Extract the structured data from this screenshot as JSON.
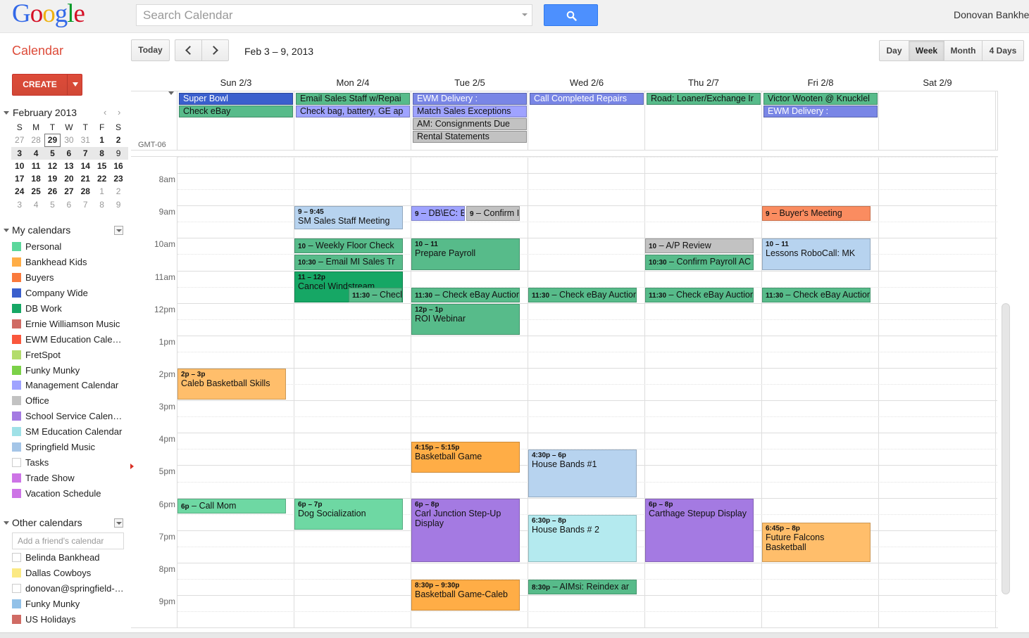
{
  "header": {
    "logo_letters": [
      {
        "ch": "G",
        "color": "#3369e8"
      },
      {
        "ch": "o",
        "color": "#d50f25"
      },
      {
        "ch": "o",
        "color": "#eeb211"
      },
      {
        "ch": "g",
        "color": "#3369e8"
      },
      {
        "ch": "l",
        "color": "#009925"
      },
      {
        "ch": "e",
        "color": "#d50f25"
      }
    ],
    "search_placeholder": "Search Calendar",
    "user_name": "Donovan Bankhe"
  },
  "toolbar": {
    "app_title": "Calendar",
    "today_label": "Today",
    "date_range": "Feb 3 – 9, 2013",
    "views": {
      "day": "Day",
      "week": "Week",
      "month": "Month",
      "four_days": "4 Days"
    },
    "active_view": "Week"
  },
  "sidebar": {
    "create_label": "CREATE",
    "minical": {
      "title": "February 2013",
      "prev": "‹",
      "next": "›",
      "weekdays": [
        "S",
        "M",
        "T",
        "W",
        "T",
        "F",
        "S"
      ],
      "weeks": [
        [
          {
            "d": "27",
            "o": true
          },
          {
            "d": "28",
            "o": true
          },
          {
            "d": "29",
            "t": true
          },
          {
            "d": "30",
            "o": true
          },
          {
            "d": "31",
            "o": true
          },
          {
            "d": "1",
            "b": true
          },
          {
            "d": "2",
            "b": true
          }
        ],
        [
          {
            "d": "3",
            "b": true,
            "w": true
          },
          {
            "d": "4",
            "b": true,
            "w": true
          },
          {
            "d": "5",
            "b": true,
            "w": true
          },
          {
            "d": "6",
            "b": true,
            "w": true
          },
          {
            "d": "7",
            "b": true,
            "w": true
          },
          {
            "d": "8",
            "b": true,
            "w": true
          },
          {
            "d": "9",
            "w": true
          }
        ],
        [
          {
            "d": "10",
            "b": true
          },
          {
            "d": "11",
            "b": true
          },
          {
            "d": "12",
            "b": true
          },
          {
            "d": "13",
            "b": true
          },
          {
            "d": "14",
            "b": true
          },
          {
            "d": "15",
            "b": true
          },
          {
            "d": "16",
            "b": true
          }
        ],
        [
          {
            "d": "17",
            "b": true
          },
          {
            "d": "18",
            "b": true
          },
          {
            "d": "19",
            "b": true
          },
          {
            "d": "20",
            "b": true
          },
          {
            "d": "21",
            "b": true
          },
          {
            "d": "22",
            "b": true
          },
          {
            "d": "23",
            "b": true
          }
        ],
        [
          {
            "d": "24",
            "b": true
          },
          {
            "d": "25",
            "b": true
          },
          {
            "d": "26",
            "b": true
          },
          {
            "d": "27",
            "b": true
          },
          {
            "d": "28",
            "b": true
          },
          {
            "d": "1",
            "o": true
          },
          {
            "d": "2",
            "o": true
          }
        ],
        [
          {
            "d": "3",
            "o": true
          },
          {
            "d": "4",
            "o": true
          },
          {
            "d": "5",
            "o": true
          },
          {
            "d": "6",
            "o": true
          },
          {
            "d": "7",
            "o": true
          },
          {
            "d": "8",
            "o": true
          },
          {
            "d": "9",
            "o": true
          }
        ]
      ]
    },
    "my_calendars_title": "My calendars",
    "my_calendars": [
      {
        "name": "Personal",
        "color": "#5bd79b"
      },
      {
        "name": "Bankhead Kids",
        "color": "#ffad46"
      },
      {
        "name": "Buyers",
        "color": "#fa7a3c"
      },
      {
        "name": "Company Wide",
        "color": "#3a5fcd"
      },
      {
        "name": "DB Work",
        "color": "#16a765"
      },
      {
        "name": "Ernie Williamson Music",
        "color": "#d06b64"
      },
      {
        "name": "EWM Education Cale…",
        "color": "#fa573c"
      },
      {
        "name": "FretSpot",
        "color": "#b3dc6c"
      },
      {
        "name": "Funky Munky",
        "color": "#7bd148"
      },
      {
        "name": "Management Calendar",
        "color": "#9fa3ff"
      },
      {
        "name": "Office",
        "color": "#c2c2c2"
      },
      {
        "name": "School Service Calen…",
        "color": "#a47ae2"
      },
      {
        "name": "SM Education Calendar",
        "color": "#9fe1e7"
      },
      {
        "name": "Springfield Music",
        "color": "#a4c5e7"
      },
      {
        "name": "Tasks",
        "color": "#ffffff"
      },
      {
        "name": "Trade Show",
        "color": "#cd74e6"
      },
      {
        "name": "Vacation Schedule",
        "color": "#cd74e6"
      }
    ],
    "other_calendars_title": "Other calendars",
    "friend_placeholder": "Add a friend's calendar",
    "other_calendars": [
      {
        "name": "Belinda Bankhead",
        "color": "#ffffff"
      },
      {
        "name": "Dallas Cowboys",
        "color": "#fbe983"
      },
      {
        "name": "donovan@springfield-…",
        "color": "#ffffff"
      },
      {
        "name": "Funky Munky",
        "color": "#92c1e8"
      },
      {
        "name": "US Holidays",
        "color": "#d06b64"
      }
    ]
  },
  "grid": {
    "timezone": "GMT-06",
    "days": [
      "Sun 2/3",
      "Mon 2/4",
      "Tue 2/5",
      "Wed 2/6",
      "Thu 2/7",
      "Fri 2/8",
      "Sat 2/9"
    ],
    "hours": [
      "8am",
      "9am",
      "10am",
      "11am",
      "12pm",
      "1pm",
      "2pm",
      "3pm",
      "4pm",
      "5pm",
      "6pm",
      "7pm",
      "8pm",
      "9pm"
    ],
    "all_day_events": [
      {
        "day": 0,
        "row": 0,
        "title": "Super Bowl",
        "color": "#3a5fcd",
        "text": "#ffffff"
      },
      {
        "day": 0,
        "row": 1,
        "title": "Check eBay",
        "color": "#57bb8a",
        "text": "#111111"
      },
      {
        "day": 1,
        "row": 0,
        "title": "Email Sales Staff w/Repai",
        "color": "#57bb8a",
        "text": "#111111"
      },
      {
        "day": 1,
        "row": 1,
        "title": "Check bag, battery, GE ap",
        "color": "#9fa3ff",
        "text": "#111111"
      },
      {
        "day": 2,
        "row": 0,
        "title": "EWM Delivery :",
        "color": "#7986e6",
        "text": "#ffffff"
      },
      {
        "day": 2,
        "row": 1,
        "title": "Match Sales Exceptions",
        "color": "#9fa3ff",
        "text": "#111111"
      },
      {
        "day": 2,
        "row": 2,
        "title": "AM: Consignments Due",
        "color": "#c2c2c2",
        "text": "#111111"
      },
      {
        "day": 2,
        "row": 3,
        "title": "Rental Statements",
        "color": "#c2c2c2",
        "text": "#111111"
      },
      {
        "day": 3,
        "row": 0,
        "title": "Call Completed Repairs",
        "color": "#7986e6",
        "text": "#ffffff"
      },
      {
        "day": 4,
        "row": 0,
        "title": "Road: Loaner/Exchange Ir",
        "color": "#57bb8a",
        "text": "#111111"
      },
      {
        "day": 5,
        "row": 0,
        "title": "Victor Wooten @ Knucklel",
        "color": "#57bb8a",
        "text": "#111111"
      },
      {
        "day": 5,
        "row": 1,
        "title": "EWM Delivery :",
        "color": "#7986e6",
        "text": "#ffffff"
      }
    ],
    "events": [
      {
        "day": 0,
        "start": 14,
        "end": 15,
        "time": "2p – 3p",
        "title": "Caleb Basketball Skills",
        "color": "#ffbe6b",
        "lane": 0,
        "lanes": 1
      },
      {
        "day": 0,
        "start": 18,
        "end": 18.5,
        "time": "6p",
        "title": "Call Mom",
        "color": "#6ed8a3",
        "single": true,
        "lane": 0,
        "lanes": 1
      },
      {
        "day": 1,
        "start": 9,
        "end": 9.75,
        "time": "9 – 9:45",
        "title": "SM Sales Staff Meeting",
        "color": "#b7d3ef",
        "lane": 0,
        "lanes": 1
      },
      {
        "day": 1,
        "start": 10,
        "end": 10.5,
        "time": "10",
        "title": "Weekly Floor Check",
        "color": "#57bb8a",
        "single": true,
        "lane": 0,
        "lanes": 1
      },
      {
        "day": 1,
        "start": 10.5,
        "end": 11,
        "time": "10:30",
        "title": "Email MI Sales Tr",
        "color": "#57bb8a",
        "single": true,
        "lane": 0,
        "lanes": 1
      },
      {
        "day": 1,
        "start": 11,
        "end": 12,
        "time": "11 – 12p",
        "title": "Cancel Windstream",
        "color": "#16a765",
        "lane": 0,
        "lanes": 1
      },
      {
        "day": 1,
        "start": 11.5,
        "end": 12,
        "time": "11:30",
        "title": "Check eBay Auctions",
        "color": "#57bb8a",
        "single": true,
        "offset": 77,
        "width": 76
      },
      {
        "day": 1,
        "start": 18,
        "end": 19,
        "time": "6p – 7p",
        "title": "Dog Socialization",
        "color": "#6ed8a3",
        "lane": 0,
        "lanes": 1
      },
      {
        "day": 2,
        "start": 9,
        "end": 9.5,
        "time": "9",
        "title": "DB\\EC: E",
        "color": "#9fa3ff",
        "single": true,
        "offset": 0,
        "width": 76
      },
      {
        "day": 2,
        "start": 9,
        "end": 9.5,
        "time": "9",
        "title": "Confirm I",
        "color": "#c2c2c2",
        "single": true,
        "offset": 78,
        "width": 76
      },
      {
        "day": 2,
        "start": 10,
        "end": 11,
        "time": "10 – 11",
        "title": "Prepare Payroll",
        "color": "#57bb8a",
        "lane": 0,
        "lanes": 1
      },
      {
        "day": 2,
        "start": 11.5,
        "end": 12,
        "time": "11:30",
        "title": "Check eBay Auctions",
        "color": "#57bb8a",
        "single": true,
        "lane": 0,
        "lanes": 1
      },
      {
        "day": 2,
        "start": 12,
        "end": 13,
        "time": "12p – 1p",
        "title": "ROI Webinar",
        "color": "#57bb8a",
        "lane": 0,
        "lanes": 1
      },
      {
        "day": 2,
        "start": 16.25,
        "end": 17.25,
        "time": "4:15p – 5:15p",
        "title": "Basketball Game",
        "color": "#ffad46",
        "lane": 0,
        "lanes": 1
      },
      {
        "day": 2,
        "start": 18,
        "end": 20,
        "time": "6p – 8p",
        "title": "Carl Junction Step-Up Display",
        "color": "#a47ae2",
        "lane": 0,
        "lanes": 1
      },
      {
        "day": 2,
        "start": 20.5,
        "end": 21.5,
        "time": "8:30p – 9:30p",
        "title": "Basketball Game-Caleb",
        "color": "#ffad46",
        "lane": 0,
        "lanes": 1
      },
      {
        "day": 3,
        "start": 11.5,
        "end": 12,
        "time": "11:30",
        "title": "Check eBay Auctions",
        "color": "#57bb8a",
        "single": true,
        "lane": 0,
        "lanes": 1
      },
      {
        "day": 3,
        "start": 16.5,
        "end": 18,
        "time": "4:30p – 6p",
        "title": "House Bands #1",
        "color": "#b7d3ef",
        "lane": 0,
        "lanes": 1
      },
      {
        "day": 3,
        "start": 18.5,
        "end": 20,
        "time": "6:30p – 8p",
        "title": "House Bands # 2",
        "color": "#b4eaef",
        "lane": 0,
        "lanes": 1
      },
      {
        "day": 3,
        "start": 20.5,
        "end": 21,
        "time": "8:30p",
        "title": "AIMsi: Reindex ar",
        "color": "#57bb8a",
        "single": true,
        "lane": 0,
        "lanes": 1
      },
      {
        "day": 4,
        "start": 10,
        "end": 10.5,
        "time": "10",
        "title": "A/P Review",
        "color": "#c2c2c2",
        "single": true,
        "lane": 0,
        "lanes": 1
      },
      {
        "day": 4,
        "start": 10.5,
        "end": 11,
        "time": "10:30",
        "title": "Confirm Payroll AC",
        "color": "#57bb8a",
        "single": true,
        "lane": 0,
        "lanes": 1
      },
      {
        "day": 4,
        "start": 11.5,
        "end": 12,
        "time": "11:30",
        "title": "Check eBay Auctions",
        "color": "#57bb8a",
        "single": true,
        "lane": 0,
        "lanes": 1
      },
      {
        "day": 4,
        "start": 18,
        "end": 20,
        "time": "6p – 8p",
        "title": "Carthage Stepup Display",
        "color": "#a47ae2",
        "lane": 0,
        "lanes": 1
      },
      {
        "day": 5,
        "start": 9,
        "end": 9.5,
        "time": "9",
        "title": "Buyer's Meeting",
        "color": "#fa8c60",
        "single": true,
        "lane": 0,
        "lanes": 1
      },
      {
        "day": 5,
        "start": 10,
        "end": 11,
        "time": "10 – 11",
        "title": "Lessons RoboCall: MK",
        "color": "#b7d3ef",
        "lane": 0,
        "lanes": 1
      },
      {
        "day": 5,
        "start": 11.5,
        "end": 12,
        "time": "11:30",
        "title": "Check eBay Auctions",
        "color": "#57bb8a",
        "single": true,
        "lane": 0,
        "lanes": 1
      },
      {
        "day": 5,
        "start": 18.75,
        "end": 20,
        "time": "6:45p – 8p",
        "title": "Future Falcons Basketball",
        "color": "#ffbe6b",
        "lane": 0,
        "lanes": 1
      }
    ]
  }
}
